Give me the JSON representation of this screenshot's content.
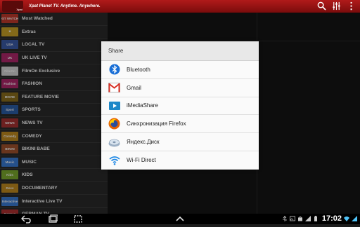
{
  "app": {
    "logo_text": "Xpat",
    "tagline": "Xpat Planet TV. Anytime. Anywhere."
  },
  "top_icons": [
    "search-icon",
    "settings-sliders-icon",
    "menu-icon"
  ],
  "sidebar": {
    "items": [
      {
        "label": "Most Watched",
        "thumb": "MOST WATCHED",
        "color": "#c0392b"
      },
      {
        "label": "Extras",
        "thumb": "★",
        "color": "#c9a227"
      },
      {
        "label": "LOCAL TV",
        "thumb": "USA",
        "color": "#3b5ba8"
      },
      {
        "label": "UK LIVE TV",
        "thumb": "UK",
        "color": "#b0276a"
      },
      {
        "label": "FilmOn Exclusive",
        "thumb": "FilmOn",
        "color": "#d6d6d6"
      },
      {
        "label": "FASHION",
        "thumb": "Fashion",
        "color": "#b0276a"
      },
      {
        "label": "FEATURE MOVIE",
        "thumb": "MOVIE",
        "color": "#8a6d1d"
      },
      {
        "label": "SPORTS",
        "thumb": "Sport",
        "color": "#2c5ea8"
      },
      {
        "label": "NEWS TV",
        "thumb": "NEWS",
        "color": "#a83232"
      },
      {
        "label": "COMEDY",
        "thumb": "Comedy",
        "color": "#c08a1f"
      },
      {
        "label": "BIKINI BABE",
        "thumb": "BIKINI",
        "color": "#a0522d"
      },
      {
        "label": "MUSIC",
        "thumb": "Music",
        "color": "#3a7bd5"
      },
      {
        "label": "KIDS",
        "thumb": "Kids",
        "color": "#7caa2d"
      },
      {
        "label": "DOCUMENTARY",
        "thumb": "Docs",
        "color": "#c08a1f"
      },
      {
        "label": "Interactive Live TV",
        "thumb": "Interactive",
        "color": "#3a7bd5"
      },
      {
        "label": "GERMAN TV",
        "thumb": "German",
        "color": "#b03030"
      }
    ]
  },
  "share_dialog": {
    "title": "Share",
    "options": [
      {
        "label": "Bluetooth",
        "icon": "bluetooth-icon"
      },
      {
        "label": "Gmail",
        "icon": "gmail-icon"
      },
      {
        "label": "iMediaShare",
        "icon": "imediashare-icon"
      },
      {
        "label": "Синхронизация Firefox",
        "icon": "firefox-icon"
      },
      {
        "label": "Яндекс.Диск",
        "icon": "yandex-disk-icon"
      },
      {
        "label": "Wi-Fi Direct",
        "icon": "wifi-direct-icon"
      }
    ]
  },
  "status_bar": {
    "time": "17:02"
  }
}
